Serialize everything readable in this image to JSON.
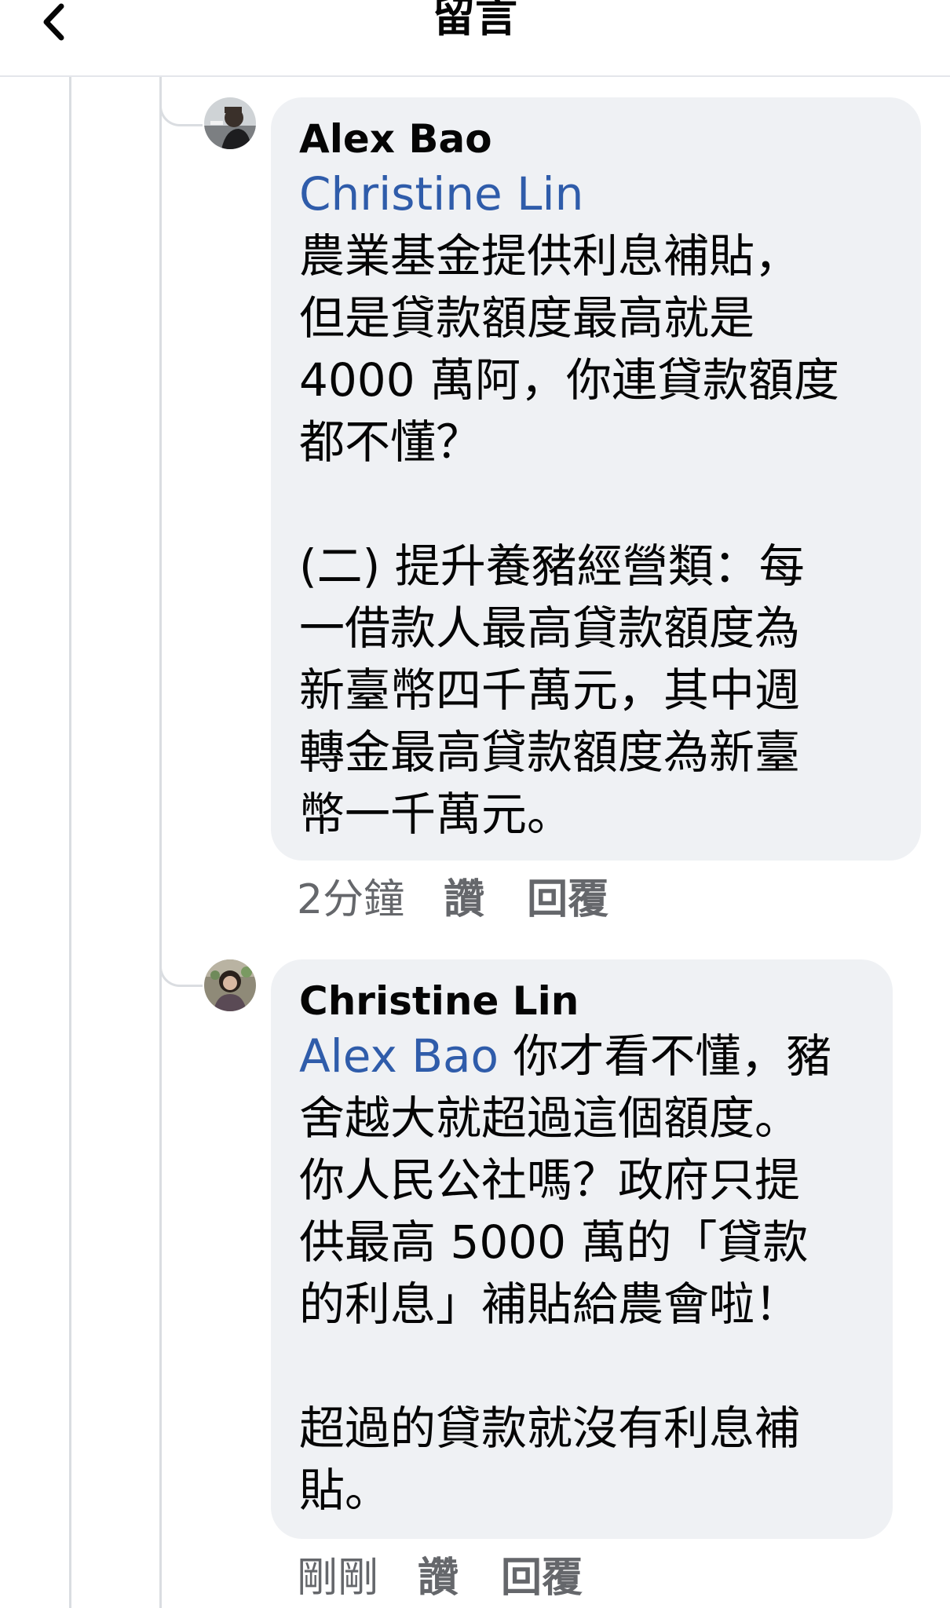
{
  "header": {
    "title": "留言",
    "back_icon": "chevron-left-icon"
  },
  "comments": [
    {
      "author": "Alex Bao",
      "mention": "Christine Lin",
      "text": "農業基金提供利息補貼，\n但是貸款額度最高就是\n4000 萬阿，你連貸款額度\n都不懂？\n\n(二) 提升養豬經營類：每\n一借款人最高貸款額度為\n新臺幣四千萬元，其中週\n轉金最高貸款額度為新臺\n幣一千萬元。",
      "time": "2分鐘",
      "like_label": "讚",
      "reply_label": "回覆"
    },
    {
      "author": "Christine Lin",
      "mention": "Alex Bao",
      "mention_suffix": " 你才看不懂，豬",
      "text": "舍越大就超過這個額度。\n你人民公社嗎？政府只提\n供最高 5000 萬的「貸款\n的利息」補貼給農會啦！\n\n超過的貸款就沒有利息補\n貼。",
      "time": "剛剛",
      "like_label": "讚",
      "reply_label": "回覆"
    }
  ],
  "colors": {
    "mention": "#2f5caa",
    "bubble": "#eff1f4",
    "meta_text": "#65676b",
    "thread_line": "#dadde1"
  }
}
